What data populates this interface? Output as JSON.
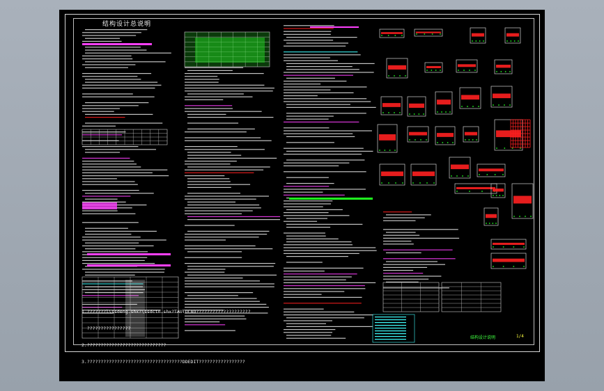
{
  "drawing": {
    "sheet_title": "结构设计总说明",
    "sheet_label": "结构设计说明",
    "sheet_no": "1/4",
    "notes": [
      "1.???????l\\ssdeng.shx?\\ssdctn.shx?TAUTOCAD????????????????????",
      "  ????????????????",
      "2.?????????????????????????????",
      "3.???????????????????????????????????DDEDIT?????????????????"
    ]
  },
  "colors": {
    "background": "#000000",
    "viewport": "#a4acb6",
    "red": "#ff2020",
    "green": "#20ff20",
    "magenta": "#ff40ff",
    "cyan": "#40ffff",
    "yellow": "#ffff40",
    "white": "#e6e6e6"
  }
}
